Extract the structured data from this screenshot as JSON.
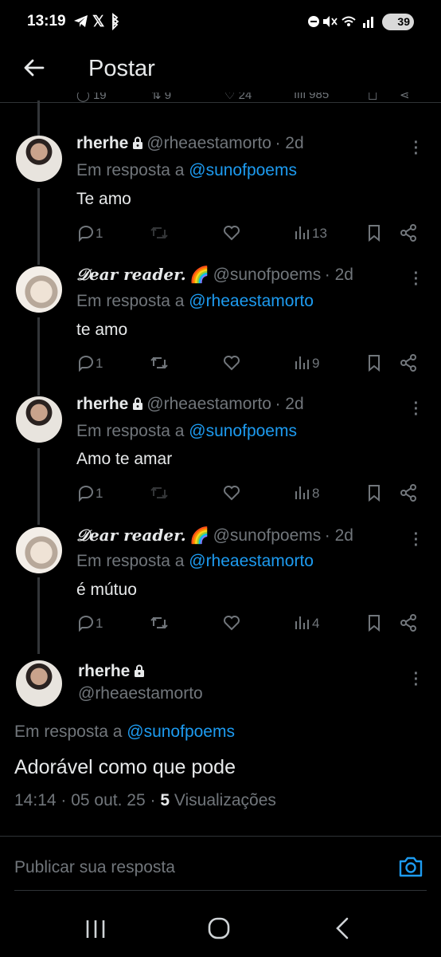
{
  "status_bar": {
    "time": "13:19",
    "battery": "39"
  },
  "header": {
    "title": "Postar"
  },
  "previous_tweet_stats": {
    "replies": "19",
    "retweets": "9",
    "likes": "24",
    "views": "985"
  },
  "tweets": [
    {
      "name": "rherhe",
      "locked": true,
      "handle": "@rheaestamorto",
      "time": "· 2d",
      "reply_prefix": "Em resposta a",
      "reply_to": "@sunofpoems",
      "text": "Te amo",
      "replies": "1",
      "views": "13"
    },
    {
      "name": "𝒟ear reader.",
      "emoji": "🌈",
      "handle": "@sunofpoems",
      "time": "· 2d",
      "reply_prefix": "Em resposta a",
      "reply_to": "@rheaestamorto",
      "text": "te amo",
      "replies": "1",
      "views": "9"
    },
    {
      "name": "rherhe",
      "locked": true,
      "handle": "@rheaestamorto",
      "time": "· 2d",
      "reply_prefix": "Em resposta a",
      "reply_to": "@sunofpoems",
      "text": "Amo te amar",
      "replies": "1",
      "views": "8"
    },
    {
      "name": "𝒟ear reader.",
      "emoji": "🌈",
      "handle": "@sunofpoems",
      "time": "· 2d",
      "reply_prefix": "Em resposta a",
      "reply_to": "@rheaestamorto",
      "text": "é mútuo",
      "replies": "1",
      "views": "4"
    }
  ],
  "main_tweet": {
    "name": "rherhe",
    "handle": "@rheaestamorto",
    "reply_prefix": "Em resposta a",
    "reply_to": "@sunofpoems",
    "text": "Adorável como que pode",
    "time": "14:14",
    "date": "05 out. 25",
    "views_count": "5",
    "views_label": "Visualizações"
  },
  "composer": {
    "placeholder": "Publicar sua resposta"
  },
  "colors": {
    "background": "#000000",
    "accent": "#1d9bf0",
    "secondary_text": "#71767b"
  }
}
